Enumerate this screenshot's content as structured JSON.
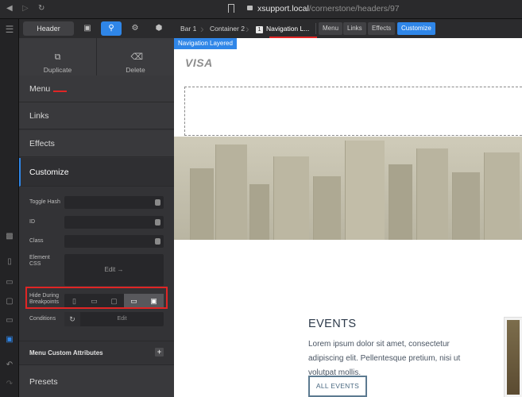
{
  "browser": {
    "url_host": "xsupport.local",
    "url_path": "/cornerstone/headers/97"
  },
  "panel": {
    "header_label": "Header",
    "duplicate_label": "Duplicate",
    "delete_label": "Delete",
    "sections": [
      "Menu",
      "Links",
      "Effects",
      "Customize"
    ],
    "fields": {
      "toggle_hash": "Toggle Hash",
      "id": "ID",
      "class": "Class",
      "element_css": "Element CSS",
      "css_edit": "Edit →",
      "hide_during_breakpoints": "Hide During Breakpoints",
      "conditions": "Conditions",
      "conditions_edit": "Edit"
    },
    "menu_custom_attributes": "Menu Custom Attributes",
    "presets": "Presets",
    "breakpoints_on": [
      3,
      4
    ]
  },
  "breadcrumbs": {
    "items": [
      "Bar 1",
      "Container 2",
      "Navigation L..."
    ],
    "active_badge": "1",
    "tabs": [
      "Menu",
      "Links",
      "Effects",
      "Customize"
    ],
    "active_tab": "Customize"
  },
  "canvas": {
    "badge": "Navigation Layered",
    "logo": "VISA",
    "events_title": "EVENTS",
    "events_text": "Lorem ipsum dolor sit amet, consectetur adipiscing elit. Pellentesque pretium, nisi ut volutpat mollis.",
    "all_events_button": "ALL EVENTS"
  },
  "colors": {
    "accent": "#2f86e8",
    "annotation_red": "#e02525"
  }
}
